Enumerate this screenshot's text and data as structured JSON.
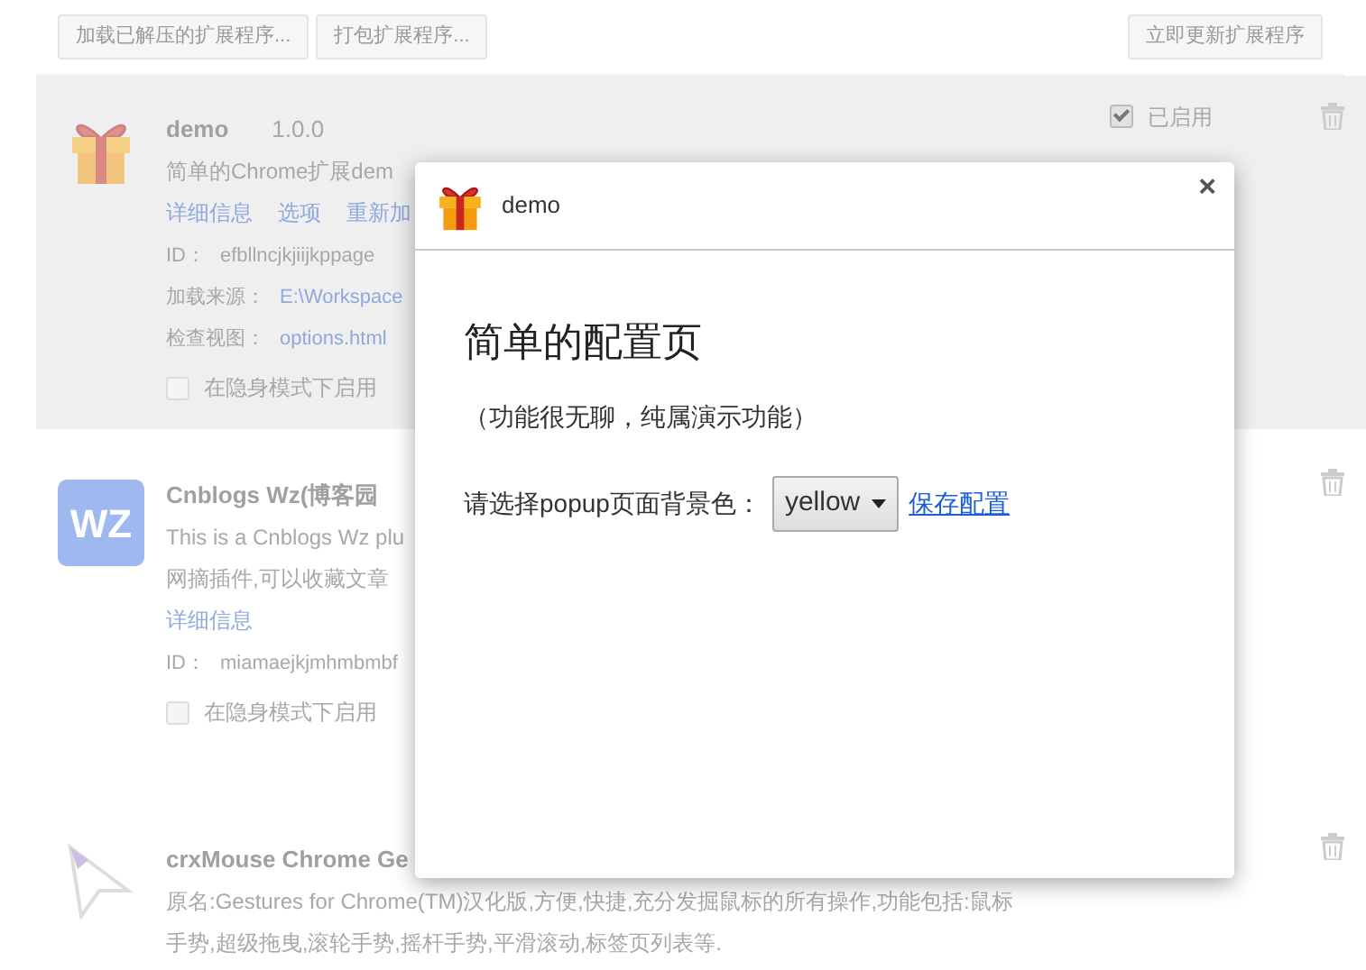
{
  "toolbar": {
    "buttons": [
      "加载已解压的扩展程序...",
      "打包扩展程序..."
    ],
    "update_button": "立即更新扩展程序"
  },
  "extensions": [
    {
      "kind": "gift",
      "highlighted": true,
      "name": "demo",
      "version": "1.0.0",
      "description": [
        "简单的Chrome扩展dem"
      ],
      "links": [
        "详细信息",
        "选项",
        "重新加"
      ],
      "fields": [
        {
          "label": "ID：",
          "value": "efbllncjkjiijkppage",
          "is_link": false
        },
        {
          "label": "加载来源：",
          "value": "E:\\Workspace",
          "is_link": true
        },
        {
          "label": "检查视图：",
          "value": "options.html",
          "is_link": true
        }
      ],
      "incognito": {
        "label": "在隐身模式下启用",
        "checked": false
      },
      "enabled": {
        "label": "已启用",
        "checked": true
      }
    },
    {
      "kind": "wz",
      "logo_text": "WZ",
      "highlighted": false,
      "name": "Cnblogs Wz(博客园",
      "description": [
        "This is a Cnblogs Wz plu",
        "网摘插件,可以收藏文章"
      ],
      "links": [
        "详细信息"
      ],
      "fields": [
        {
          "label": "ID：",
          "value": "miamaejkjmhmbmbf",
          "is_link": false
        }
      ],
      "incognito": {
        "label": "在隐身模式下启用",
        "checked": false
      }
    },
    {
      "kind": "cursor",
      "highlighted": false,
      "name": "crxMouse Chrome Ge",
      "description": [
        "原名:Gestures for Chrome(TM)汉化版,方便,快捷,充分发掘鼠标的所有操作,功能包括:鼠标",
        "手势,超级拖曳,滚轮手势,摇杆手势,平滑滚动,标签页列表等."
      ]
    }
  ],
  "dialog": {
    "title": "demo",
    "close": "×",
    "heading": "简单的配置页",
    "note": "（功能很无聊，纯属演示功能）",
    "select_label": "请选择popup页面背景色：",
    "select_value": "yellow",
    "save_link": "保存配置"
  }
}
